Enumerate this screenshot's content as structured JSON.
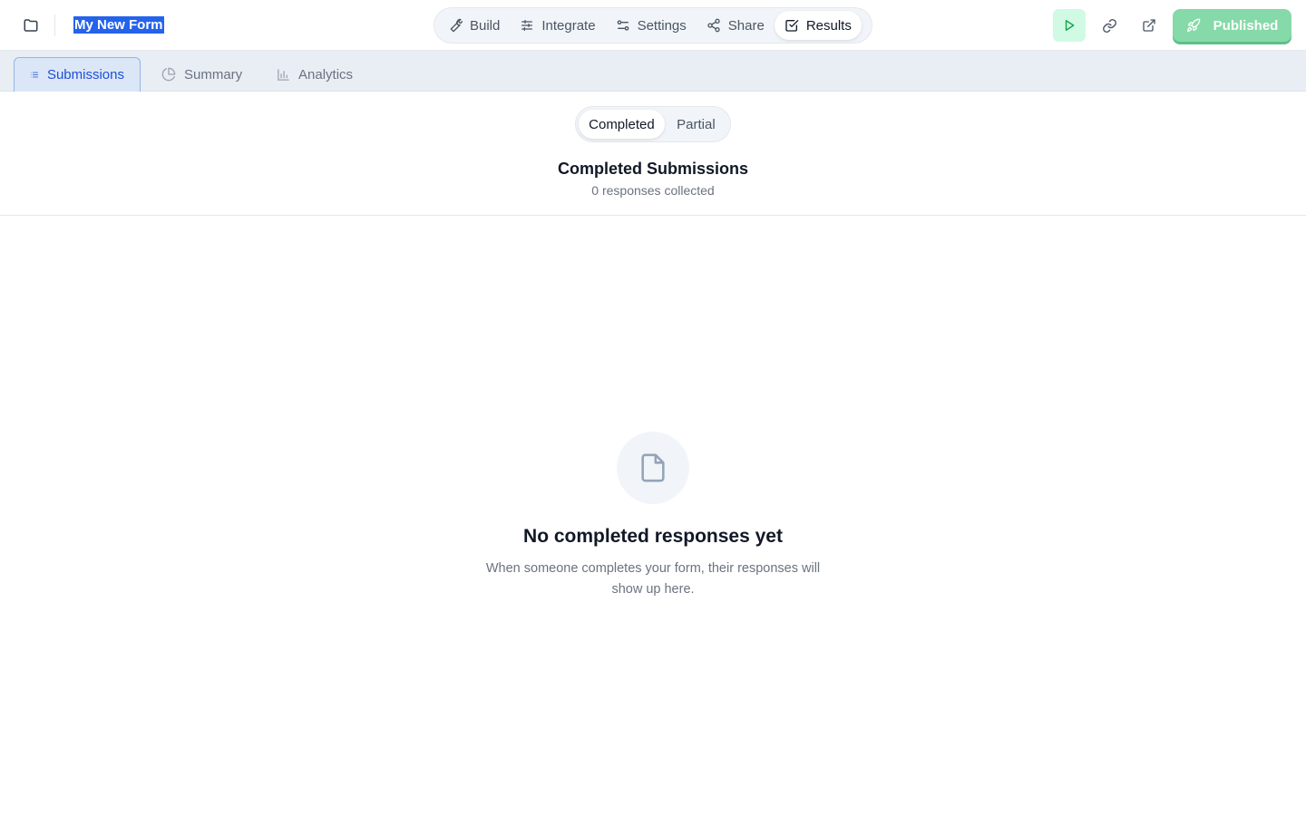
{
  "header": {
    "form_title": "My New Form",
    "nav": [
      {
        "label": "Build",
        "icon": "wrench-icon"
      },
      {
        "label": "Integrate",
        "icon": "sliders-icon"
      },
      {
        "label": "Settings",
        "icon": "settings-icon"
      },
      {
        "label": "Share",
        "icon": "share-icon"
      },
      {
        "label": "Results",
        "icon": "checkbox-icon",
        "active": true
      }
    ],
    "published_label": "Published"
  },
  "subtabs": [
    {
      "label": "Submissions",
      "icon": "list-icon",
      "active": true
    },
    {
      "label": "Summary",
      "icon": "pie-icon"
    },
    {
      "label": "Analytics",
      "icon": "bar-chart-icon"
    }
  ],
  "toggle": {
    "completed": "Completed",
    "partial": "Partial",
    "selected": "Completed"
  },
  "results": {
    "title": "Completed Submissions",
    "count_text": "0 responses collected"
  },
  "empty_state": {
    "title": "No completed responses yet",
    "description": "When someone completes your form, their responses will show up here."
  },
  "colors": {
    "accent": "#2563eb",
    "published": "#86d9a8",
    "preview_bg": "#d1fae5",
    "subtabs_bg": "#e9eef4"
  }
}
